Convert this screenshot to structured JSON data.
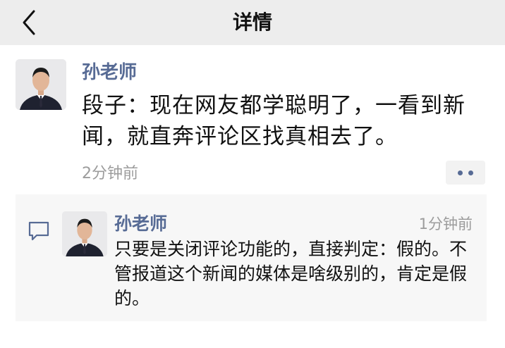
{
  "header": {
    "title": "详情",
    "back_icon": "chevron-left-icon"
  },
  "post": {
    "author": "孙老师",
    "text": "段子：现在网友都学聪明了，一看到新闻，就直奔评论区找真相去了。",
    "time": "2分钟前",
    "more_icon": "ellipsis-icon"
  },
  "comment": {
    "icon": "comment-bubble-icon",
    "author": "孙老师",
    "time": "1分钟前",
    "text": "只要是关闭评论功能的，直接判定：假的。不管报道这个新闻的媒体是啥级别的，肯定是假的。"
  },
  "colors": {
    "topbar_bg": "#ededed",
    "name_link": "#576b95",
    "meta_gray": "#9c9c9c",
    "comment_bg": "#f7f7f7"
  }
}
